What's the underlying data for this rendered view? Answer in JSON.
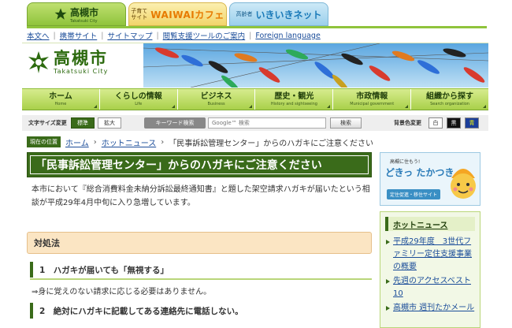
{
  "portal_tabs": [
    {
      "title": "高槻市",
      "subtitle": "Takatsuki City"
    },
    {
      "small_line1": "子育て",
      "small_line2": "サイト",
      "title": "WAIWAIカフェ"
    },
    {
      "small": "高齢者",
      "title": "いきいきネット"
    }
  ],
  "utility_links": [
    "本文へ",
    "携帯サイト",
    "サイトマップ",
    "閲覧支援ツールのご案内",
    "Foreign language"
  ],
  "logo": {
    "jp": "高槻市",
    "en": "Takatsuki City"
  },
  "global_nav": [
    {
      "jp": "ホーム",
      "en": "Home"
    },
    {
      "jp": "くらしの情報",
      "en": "Life"
    },
    {
      "jp": "ビジネス",
      "en": "Business"
    },
    {
      "jp": "歴史・観光",
      "en": "History and sightseeing"
    },
    {
      "jp": "市政情報",
      "en": "Municipal government"
    },
    {
      "jp": "組織から探す",
      "en": "Search organization"
    }
  ],
  "toolbar": {
    "font_size_label": "文字サイズ変更",
    "standard": "標準",
    "enlarge": "拡大",
    "keyword_label": "キーワード検索",
    "search_placeholder": "Google™ 検索",
    "search_button": "検索",
    "bg_label": "背景色変更",
    "bg_white": "白",
    "bg_black": "黒",
    "bg_blue": "青"
  },
  "breadcrumb": {
    "now_label": "現在の位置",
    "items": [
      "ホーム",
      "ホットニュース"
    ],
    "current": "「民事訴訟管理センター」からのハガキにご注意ください"
  },
  "main": {
    "title": "「民事訴訟管理センター」からのハガキにご注意ください",
    "intro": "本市において『総合消費料金未納分訴訟最終通知書』と題した架空請求ハガキが届いたという相談が平成29年4月中旬に入り急増しています。",
    "section_title": "対処法",
    "step1_title": "1　ハガキが届いても「無視する」",
    "step1_text": "⇒身に覚えのない請求に応じる必要はありません。",
    "step2_title": "2　絶対にハガキに記載してある連絡先に電話しない。"
  },
  "side": {
    "banner_small": "高槻に住もう!",
    "banner_big": "どきっ たかつき",
    "banner_tag": "定住促進・移住サイト",
    "hot_news_title": "ホットニュース",
    "hot_news": [
      "平成29年度　3世代ファミリー定住支援事業の概要",
      "先週のアクセスベスト10",
      "高槻市 週刊たかメール"
    ]
  },
  "colors": {
    "accent_green": "#3a6b1a",
    "nav_green": "#a9d04a",
    "link_blue": "#1a4c99"
  }
}
